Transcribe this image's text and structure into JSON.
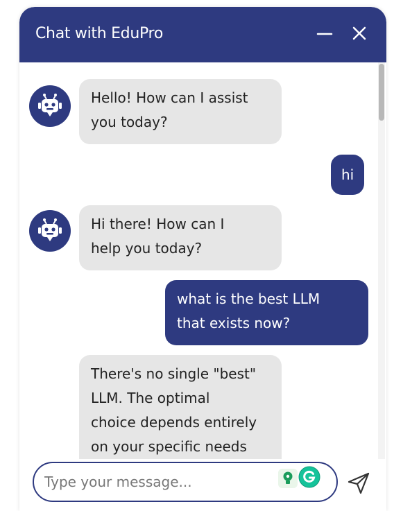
{
  "header": {
    "title": "Chat with EduPro",
    "minimize_icon": "minimize-icon",
    "close_icon": "close-icon"
  },
  "messages": [
    {
      "sender": "bot",
      "text": "Hello! How can I assist\nyou today?"
    },
    {
      "sender": "user",
      "text": "hi"
    },
    {
      "sender": "bot",
      "text": "Hi there! How can I\nhelp you today?"
    },
    {
      "sender": "user",
      "text": "what is the best LLM\nthat exists now?"
    },
    {
      "sender": "bot",
      "text": "There's no single \"best\"\nLLM. The optimal\nchoice depends entirely\non your specific needs"
    }
  ],
  "composer": {
    "placeholder": "Type your message...",
    "value": "",
    "send_icon": "send-icon"
  },
  "colors": {
    "brand": "#2e3a80",
    "bot_bubble": "#e6e6e6",
    "user_text": "#ffffff"
  }
}
